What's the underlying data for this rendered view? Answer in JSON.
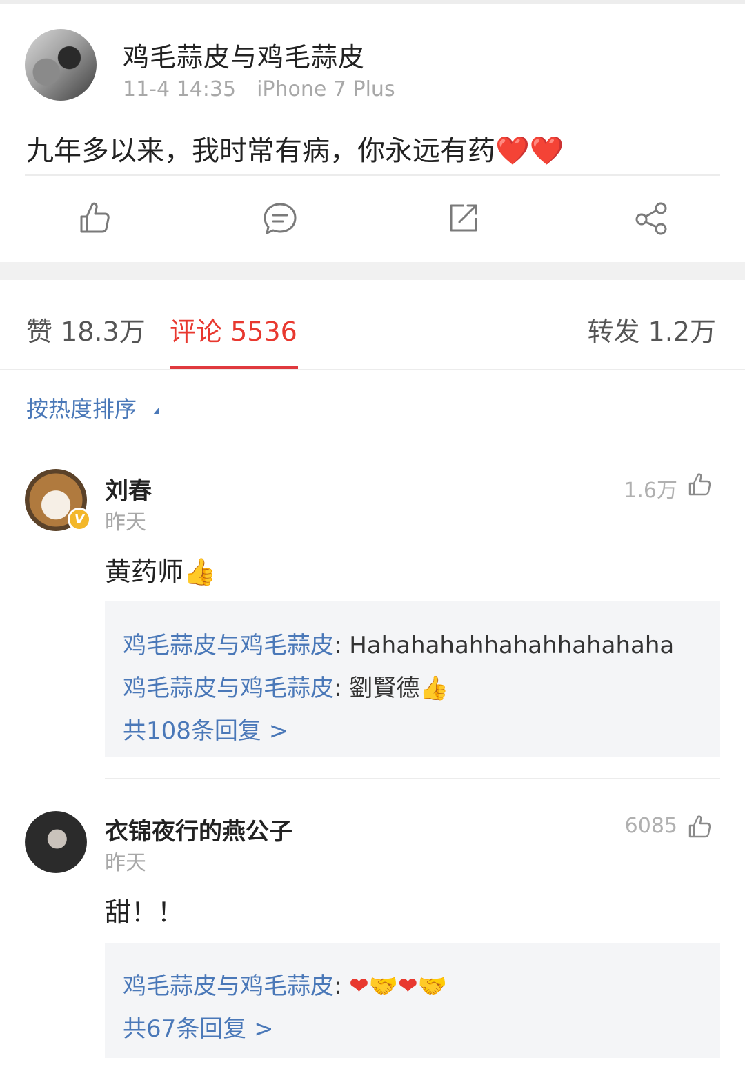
{
  "post": {
    "author": "鸡毛蒜皮与鸡毛蒜皮",
    "time": "11-4 14:35",
    "device": "iPhone 7 Plus",
    "text": "九年多以来，我时常有病，你永远有药",
    "text_emoji": "❤️❤️"
  },
  "actions": [
    {
      "icon": "like-icon"
    },
    {
      "icon": "comment-icon"
    },
    {
      "icon": "repost-icon"
    },
    {
      "icon": "share-icon"
    }
  ],
  "tabs": {
    "likes": "赞 18.3万",
    "comments": "评论 5536",
    "reposts": "转发 1.2万"
  },
  "sort_label": "按热度排序",
  "comments": [
    {
      "name": "刘春",
      "time": "昨天",
      "likes": "1.6万",
      "text": "黄药师",
      "text_emoji": "👍",
      "verified_badge": "V",
      "replies": [
        {
          "author": "鸡毛蒜皮与鸡毛蒜皮",
          "sep": ": ",
          "text": "Hahahahahhahahhahahaha"
        },
        {
          "author": "鸡毛蒜皮与鸡毛蒜皮",
          "sep": ": ",
          "text": "劉賢德",
          "emoji": "👍"
        }
      ],
      "more": "共108条回复 >"
    },
    {
      "name": "衣锦夜行的燕公子",
      "time": "昨天",
      "likes": "6085",
      "text": "甜！！",
      "replies": [
        {
          "author": "鸡毛蒜皮与鸡毛蒜皮",
          "sep": ": ",
          "emoji": "❤🤝❤🤝"
        }
      ],
      "more": "共67条回复 >"
    }
  ],
  "colors": {
    "accent_red": "#e8382f",
    "link_blue": "#4a78b8",
    "reply_bg": "#f4f5f7"
  }
}
